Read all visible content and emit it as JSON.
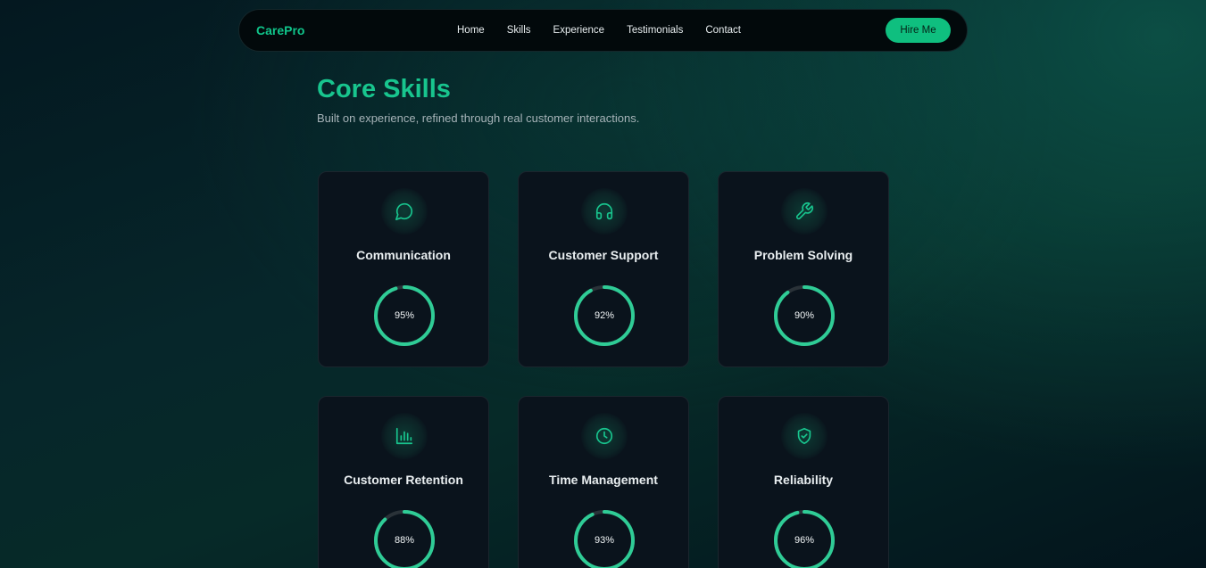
{
  "nav": {
    "brand": "CarePro",
    "links": [
      "Home",
      "Skills",
      "Experience",
      "Testimonials",
      "Contact"
    ],
    "cta": "Hire Me"
  },
  "section": {
    "title": "Core Skills",
    "subtitle": "Built on experience, refined through real customer interactions."
  },
  "colors": {
    "accent": "#18c58e",
    "ring_track": "#2a3238",
    "card_bg": "#0a131c"
  },
  "skills": [
    {
      "name": "Communication",
      "percent": 95,
      "label": "95%",
      "icon": "chat-bubble-icon"
    },
    {
      "name": "Customer Support",
      "percent": 92,
      "label": "92%",
      "icon": "headphones-icon"
    },
    {
      "name": "Problem Solving",
      "percent": 90,
      "label": "90%",
      "icon": "wrench-icon"
    },
    {
      "name": "Customer Retention",
      "percent": 88,
      "label": "88%",
      "icon": "bar-chart-icon"
    },
    {
      "name": "Time Management",
      "percent": 93,
      "label": "93%",
      "icon": "clock-icon"
    },
    {
      "name": "Reliability",
      "percent": 96,
      "label": "96%",
      "icon": "shield-check-icon"
    }
  ]
}
